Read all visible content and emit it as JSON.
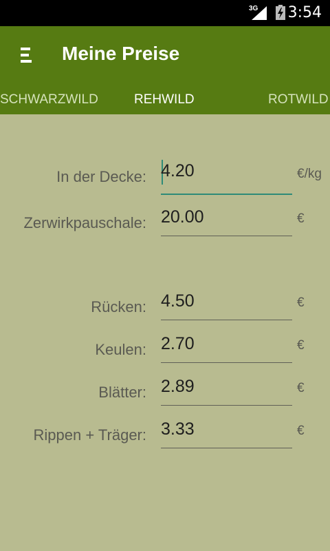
{
  "status_bar": {
    "network": "3G",
    "time": "3:54"
  },
  "app_bar": {
    "title": "Meine Preise"
  },
  "tabs": [
    {
      "label": "SCHWARZWILD"
    },
    {
      "label": "REHWILD"
    },
    {
      "label": "ROTWILD"
    }
  ],
  "prices": {
    "decke": {
      "label": "In der Decke:",
      "value": "4.20",
      "unit": "€/kg"
    },
    "zerwirk": {
      "label": "Zerwirkpauschale:",
      "value": "20.00",
      "unit": "€"
    },
    "ruecken": {
      "label": "Rücken:",
      "value": "4.50",
      "unit": "€"
    },
    "keulen": {
      "label": "Keulen:",
      "value": "2.70",
      "unit": "€"
    },
    "blaetter": {
      "label": "Blätter:",
      "value": "2.89",
      "unit": "€"
    },
    "rippen": {
      "label": "Rippen + Träger:",
      "value": "3.33",
      "unit": "€"
    }
  }
}
